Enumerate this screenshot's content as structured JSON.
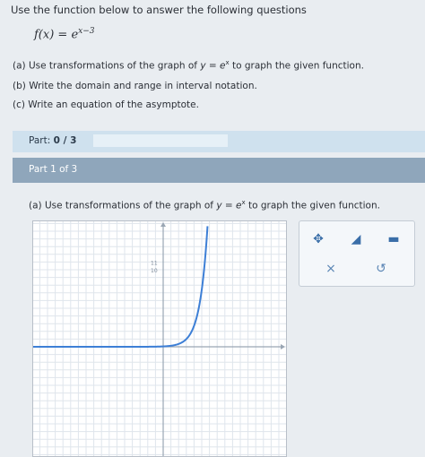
{
  "header": {
    "instructions": "Use the function below to answer the following questions",
    "formula_lhs": "f(x) = e",
    "formula_exp": "x−3"
  },
  "questions": [
    {
      "pre": "(a) Use transformations of the graph of ",
      "fn": "y = e",
      "sup": "x",
      "post": " to graph the given function."
    },
    {
      "text": "(b) Write the domain and range in interval notation."
    },
    {
      "text": "(c) Write an equation of the asymptote."
    }
  ],
  "part_bar": {
    "label": "Part:",
    "value": "0 / 3",
    "progress": 0
  },
  "part_of": {
    "label": "Part 1 of 3"
  },
  "question_a": {
    "pre": "(a) Use transformations of the graph of ",
    "fn": "y = e",
    "sup": "x",
    "post": " to graph the given function."
  },
  "graph": {
    "xlim": [
      -10,
      10
    ],
    "ylim": [
      -10,
      11
    ],
    "y_ticks_visible": [
      "11",
      "10"
    ],
    "asymptote_y": 0,
    "colors": {
      "curve": "#3d7fd6",
      "grid": "#dfe5ec",
      "axis": "#9aa6b3"
    }
  },
  "tools": [
    {
      "name": "move-tool",
      "icon": "move-arrows-icon",
      "glyph": "✥"
    },
    {
      "name": "exponential-tool",
      "icon": "exponential-curve-icon",
      "glyph": "◢"
    },
    {
      "name": "asymptote-tool",
      "icon": "asymptote-line-icon",
      "glyph": "▬"
    },
    {
      "name": "clear-tool",
      "icon": "close-icon",
      "glyph": "×"
    },
    {
      "name": "undo-tool",
      "icon": "undo-icon",
      "glyph": "↺"
    }
  ]
}
